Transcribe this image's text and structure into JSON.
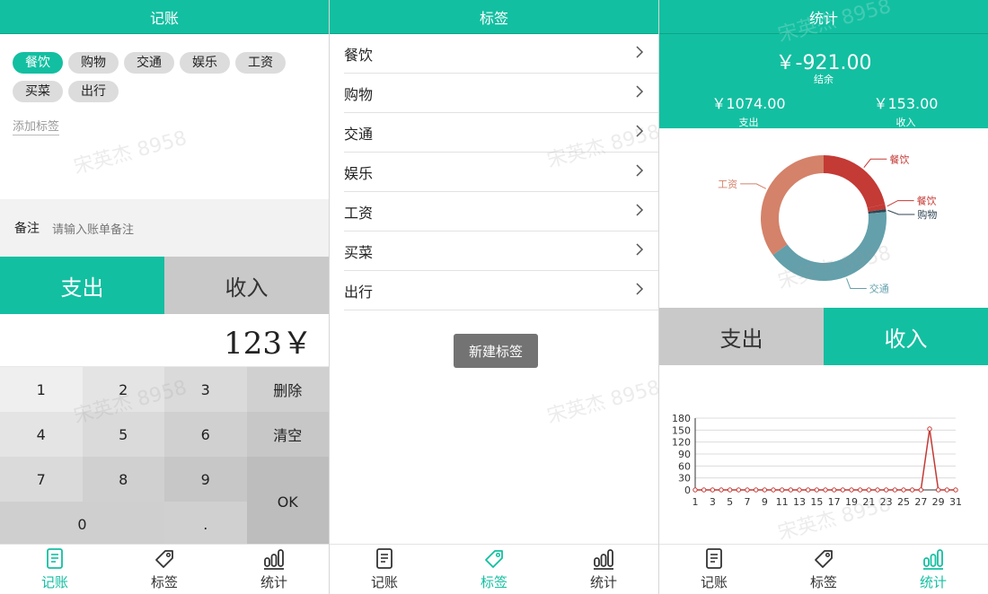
{
  "watermark": "宋英杰 8958",
  "tabbar": [
    {
      "label": "记账",
      "icon": "ledger-icon"
    },
    {
      "label": "标签",
      "icon": "tag-icon"
    },
    {
      "label": "统计",
      "icon": "stats-icon"
    }
  ],
  "record": {
    "title": "记账",
    "tags": [
      "餐饮",
      "购物",
      "交通",
      "娱乐",
      "工资",
      "买菜",
      "出行"
    ],
    "selected_tag": "餐饮",
    "add_tag_label": "添加标签",
    "note_label": "备注",
    "note_placeholder": "请输入账单备注",
    "type_expense": "支出",
    "type_income": "收入",
    "amount": "123￥",
    "keys": {
      "k1": "1",
      "k2": "2",
      "k3": "3",
      "del": "删除",
      "k4": "4",
      "k5": "5",
      "k6": "6",
      "clear": "清空",
      "k7": "7",
      "k8": "8",
      "k9": "9",
      "ok": "OK",
      "k0": "0",
      "dot": "."
    }
  },
  "tags_page": {
    "title": "标签",
    "items": [
      "餐饮",
      "购物",
      "交通",
      "娱乐",
      "工资",
      "买菜",
      "出行"
    ],
    "new_button": "新建标签"
  },
  "stats": {
    "title": "统计",
    "balance": "￥-921.00",
    "balance_label": "结余",
    "expense": "￥1074.00",
    "expense_label": "支出",
    "income": "￥153.00",
    "income_label": "收入",
    "toggle_expense": "支出",
    "toggle_income": "收入",
    "colors": {
      "accent": "#13bfa1"
    }
  },
  "chart_data": [
    {
      "type": "pie",
      "variant": "donut",
      "labels": [
        "餐饮",
        "餐饮",
        "购物",
        "交通",
        "工资"
      ],
      "values": [
        230,
        14,
        8,
        446,
        376
      ],
      "colors": [
        "#c43a35",
        "#c43a35",
        "#2f4554",
        "#63a0ab",
        "#d4826a"
      ]
    },
    {
      "type": "line",
      "x": [
        1,
        2,
        3,
        4,
        5,
        6,
        7,
        8,
        9,
        10,
        11,
        12,
        13,
        14,
        15,
        16,
        17,
        18,
        19,
        20,
        21,
        22,
        23,
        24,
        25,
        26,
        27,
        28,
        29,
        30,
        31
      ],
      "x_ticks": [
        1,
        3,
        5,
        7,
        9,
        11,
        13,
        15,
        17,
        19,
        21,
        23,
        25,
        27,
        29,
        31
      ],
      "y_ticks": [
        0,
        30,
        60,
        90,
        120,
        150,
        180
      ],
      "ylim": [
        0,
        180
      ],
      "series": [
        {
          "values": [
            0,
            0,
            0,
            0,
            0,
            0,
            0,
            0,
            0,
            0,
            0,
            0,
            0,
            0,
            0,
            0,
            0,
            0,
            0,
            0,
            0,
            0,
            0,
            0,
            0,
            0,
            0,
            153,
            0,
            0,
            0
          ]
        }
      ],
      "color": "#c43a35",
      "grid": true
    }
  ]
}
